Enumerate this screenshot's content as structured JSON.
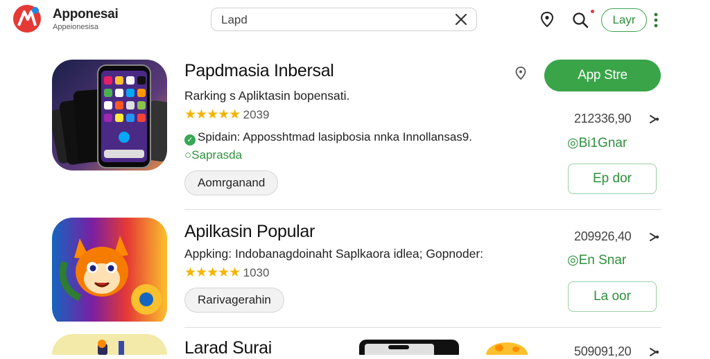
{
  "header": {
    "brand": "Apponesai",
    "brand_sub": "Appeionesisa",
    "search_value": "Lapd",
    "account_button": "Layr"
  },
  "apps": [
    {
      "title": "Papdmasia Inbersal",
      "subtitle": "Rarking s Apliktasin bopensati.",
      "stars": "★★★★★",
      "rating_count": "2039",
      "desc": "Spidain: Apposshtmad lasipbosia nnka Innollansas9.",
      "status": "Saprasda",
      "tag": "Aomrganand",
      "primary_button": "App Stre",
      "number": "212336,90",
      "size_label": "Bi1Gnar",
      "secondary_button": "Ep dor"
    },
    {
      "title": "Apilkasin Popular",
      "subtitle": "Appking: Indobanagdoinaht Saplkaora idlea; Gopnoder:",
      "stars": "★★★★★",
      "rating_count": "1030",
      "tag": "Rarivagerahin",
      "number": "209926,40",
      "size_label": "En Snar",
      "secondary_button": "La oor"
    },
    {
      "title": "Larad Surai",
      "number": "509091,20"
    }
  ],
  "colors": {
    "accent": "#3aa449",
    "star": "#f4b400",
    "logo_red": "#e53935"
  },
  "icons": [
    "logo-icon",
    "close-icon",
    "location-pin-icon",
    "search-icon",
    "more-vert-icon",
    "share-icon"
  ]
}
